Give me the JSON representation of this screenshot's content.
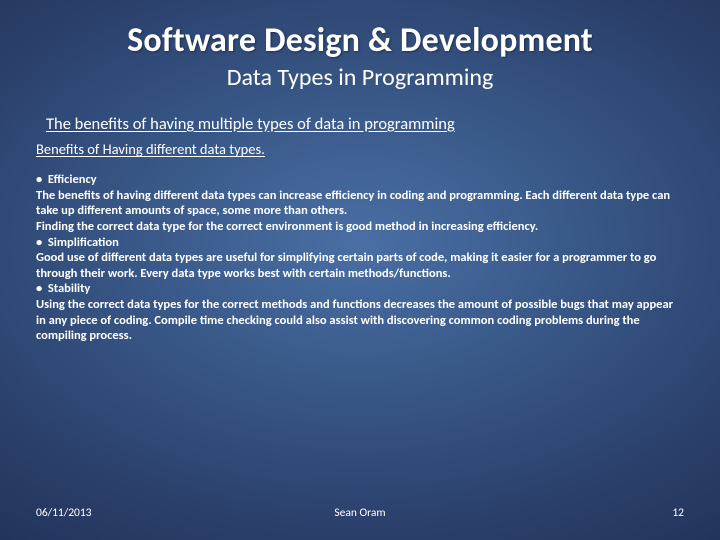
{
  "title": "Software Design & Development",
  "subtitle": "Data Types in Programming",
  "tagline": "The benefits of having multiple types of data in programming",
  "section_head": "Benefits of Having different data types.",
  "bullets": [
    {
      "label": "Efficiency",
      "text": "The benefits of having different data types can increase efficiency in coding and programming. Each different data type can take up different amounts of space, some more than others.\nFinding the correct data type for the correct environment is good method in increasing efficiency."
    },
    {
      "label": "Simplification",
      "text": "Good use of different data types are useful for simplifying certain parts of code, making it easier for a programmer to go through their work. Every data type works best with certain methods/functions."
    },
    {
      "label": "Stability",
      "text": "Using the correct data types for the correct methods and functions decreases the amount of possible bugs that may appear in any piece of coding. Compile time checking could also assist with discovering common coding problems during the compiling process."
    }
  ],
  "footer": {
    "date": "06/11/2013",
    "author": "Sean Oram",
    "page": "12"
  }
}
